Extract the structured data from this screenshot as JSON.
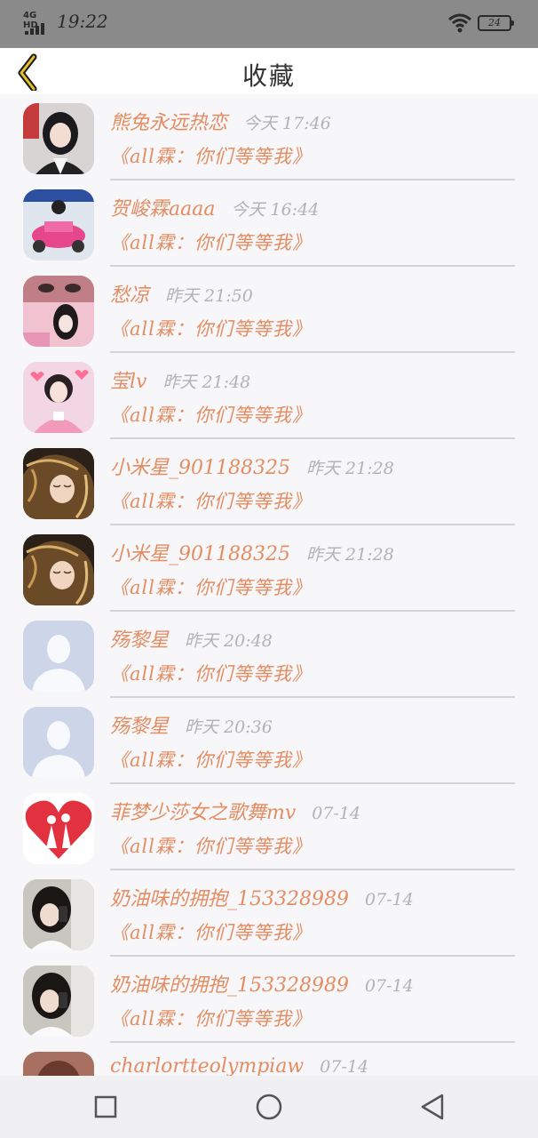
{
  "status_bar": {
    "network": "4G HD",
    "time": "19:22",
    "battery": "24"
  },
  "header": {
    "title": "收藏"
  },
  "items": [
    {
      "name": "熊兔永远热恋",
      "time": "今天 17:46",
      "subtitle": "《all霖：你们等等我》",
      "avatar": "photo-girl-black-hair"
    },
    {
      "name": "贺峻霖aaaa",
      "time": "今天 16:44",
      "subtitle": "《all霖：你们等等我》",
      "avatar": "photo-boy-pink-car"
    },
    {
      "name": "愁凉",
      "time": "昨天 21:50",
      "subtitle": "《all霖：你们等等我》",
      "avatar": "photo-girl-pink"
    },
    {
      "name": "莹lv",
      "time": "昨天 21:48",
      "subtitle": "《all霖：你们等等我》",
      "avatar": "photo-boy-hearts"
    },
    {
      "name": "小米星_901188325",
      "time": "昨天 21:28",
      "subtitle": "《all霖：你们等等我》",
      "avatar": "illustration-girl-golden"
    },
    {
      "name": "小米星_901188325",
      "time": "昨天 21:28",
      "subtitle": "《all霖：你们等等我》",
      "avatar": "illustration-girl-golden"
    },
    {
      "name": "殇黎星",
      "time": "昨天 20:48",
      "subtitle": "《all霖：你们等等我》",
      "avatar": "default-avatar"
    },
    {
      "name": "殇黎星",
      "time": "昨天 20:36",
      "subtitle": "《all霖：你们等等我》",
      "avatar": "default-avatar"
    },
    {
      "name": "菲梦少莎女之歌舞mv",
      "time": "07-14",
      "subtitle": "《all霖：你们等等我》",
      "avatar": "heart-couple"
    },
    {
      "name": "奶油味的拥抱_153328989",
      "time": "07-14",
      "subtitle": "《all霖：你们等等我》",
      "avatar": "photo-girl-phone"
    },
    {
      "name": "奶油味的拥抱_153328989",
      "time": "07-14",
      "subtitle": "《all霖：你们等等我》",
      "avatar": "photo-girl-phone"
    },
    {
      "name": "charlortteolympiaw",
      "time": "07-14",
      "subtitle": "",
      "avatar": "photo-partial"
    }
  ],
  "colors": {
    "accent": "#e38d63",
    "time": "#b3b3b3",
    "divider": "#d4d4d4",
    "back_arrow": "#c9a41c"
  },
  "nav": {
    "icons": [
      "square-icon",
      "circle-home-icon",
      "triangle-back-icon"
    ]
  }
}
